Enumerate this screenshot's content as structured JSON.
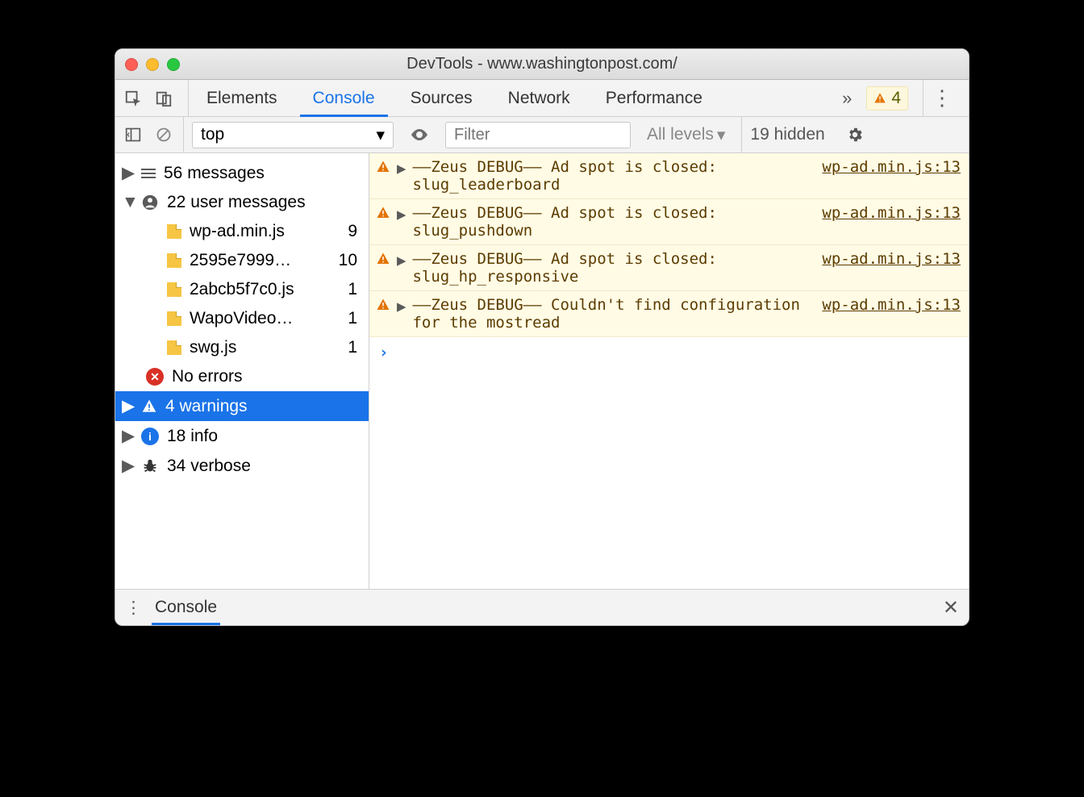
{
  "window": {
    "title": "DevTools - www.washingtonpost.com/"
  },
  "tabs": {
    "items": [
      "Elements",
      "Console",
      "Sources",
      "Network",
      "Performance"
    ],
    "active_index": 1,
    "warning_count": "4"
  },
  "toolbar": {
    "context": "top",
    "filter_placeholder": "Filter",
    "level_label": "All levels",
    "hidden_label": "19 hidden"
  },
  "sidebar": {
    "groups": [
      {
        "type": "messages",
        "label": "56 messages",
        "expandable": true,
        "expanded": false
      },
      {
        "type": "user",
        "label": "22 user messages",
        "expandable": true,
        "expanded": true,
        "children": [
          {
            "name": "wp-ad.min.js",
            "count": "9"
          },
          {
            "name": "2595e7999…",
            "count": "10"
          },
          {
            "name": "2abcb5f7c0.js",
            "count": "1"
          },
          {
            "name": "WapoVideo…",
            "count": "1"
          },
          {
            "name": "swg.js",
            "count": "1"
          }
        ]
      },
      {
        "type": "errors",
        "label": "No errors",
        "expandable": false
      },
      {
        "type": "warnings",
        "label": "4 warnings",
        "expandable": true,
        "expanded": false,
        "selected": true
      },
      {
        "type": "info",
        "label": "18 info",
        "expandable": true
      },
      {
        "type": "verbose",
        "label": "34 verbose",
        "expandable": true
      }
    ]
  },
  "logs": [
    {
      "level": "warning",
      "text": "––Zeus DEBUG–– Ad spot is closed: slug_leaderboard",
      "source": "wp-ad.min.js:13"
    },
    {
      "level": "warning",
      "text": "––Zeus DEBUG–– Ad spot is closed: slug_pushdown",
      "source": "wp-ad.min.js:13"
    },
    {
      "level": "warning",
      "text": "––Zeus DEBUG–– Ad spot is closed: slug_hp_responsive",
      "source": "wp-ad.min.js:13"
    },
    {
      "level": "warning",
      "text": "––Zeus DEBUG–– Couldn't find configuration for the mostread",
      "source": "wp-ad.min.js:13"
    }
  ],
  "drawer": {
    "tab": "Console"
  }
}
